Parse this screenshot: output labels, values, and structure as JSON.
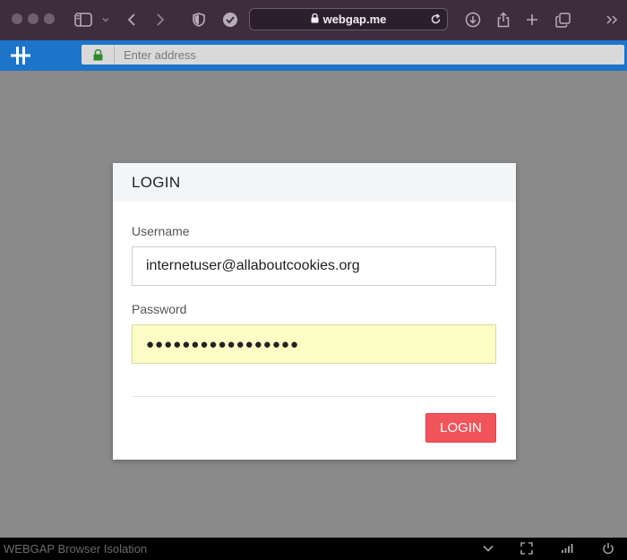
{
  "browser": {
    "url": "webgap.me"
  },
  "webgap": {
    "address_placeholder": "Enter address",
    "status_text": "WEBGAP Browser Isolation"
  },
  "login": {
    "title": "LOGIN",
    "username_label": "Username",
    "username_value": "internetuser@allaboutcookies.org",
    "password_label": "Password",
    "password_mask": "●●●●●●●●●●●●●●●●●",
    "button_label": "LOGIN"
  },
  "colors": {
    "safari_toolbar": "#3e2d3f",
    "webgap_blue": "#1d75c9",
    "page_overlay": "#8a8a8a",
    "login_button": "#f1545b",
    "password_autofill": "#fbfdc4"
  }
}
